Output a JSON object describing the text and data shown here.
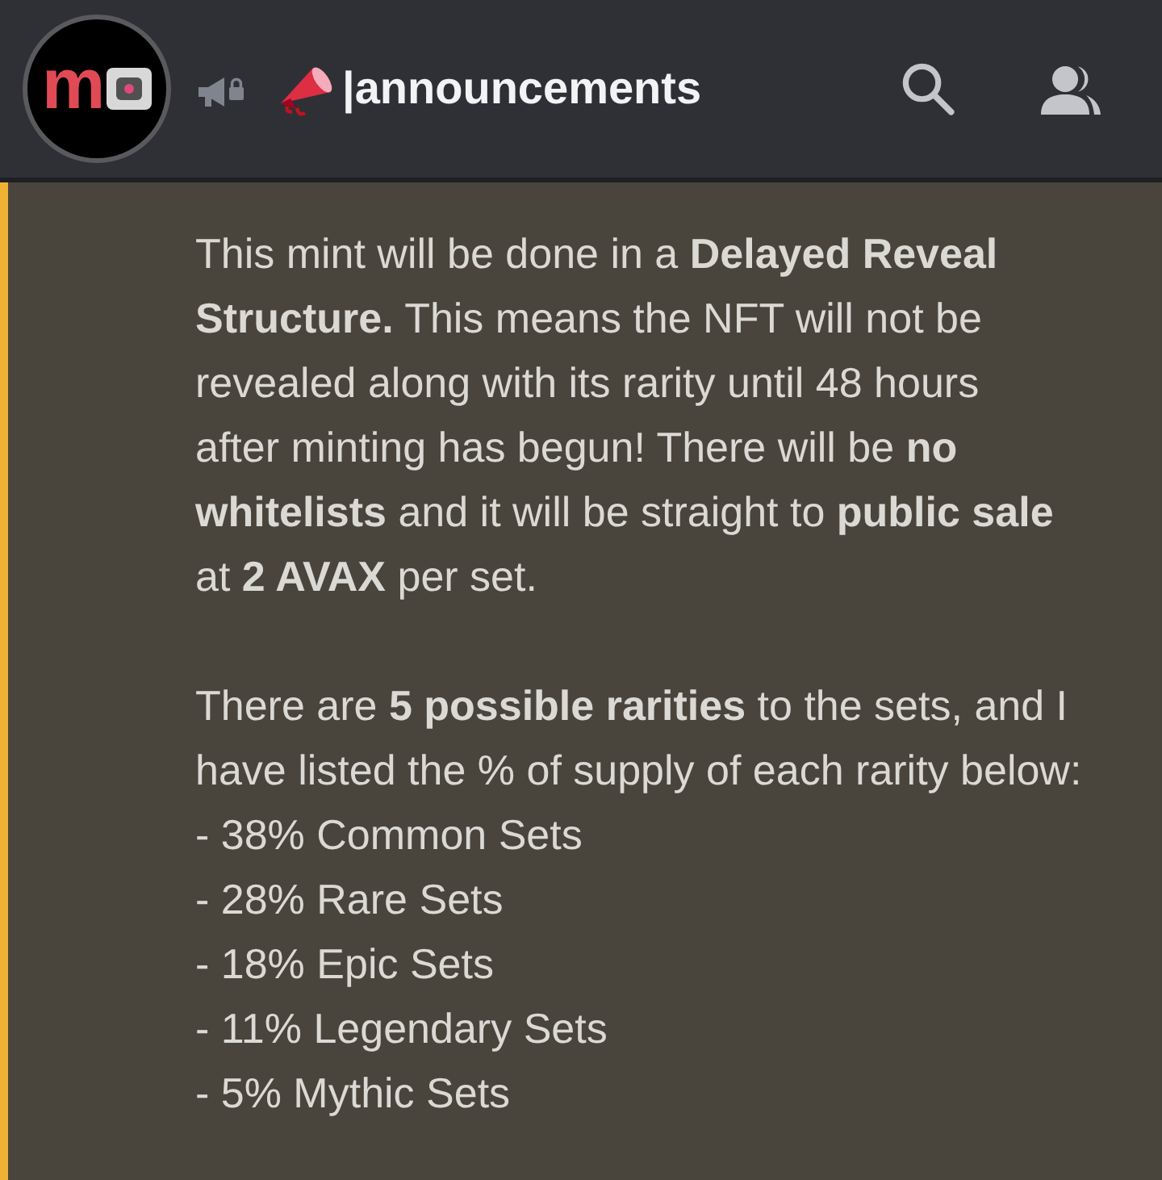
{
  "header": {
    "avatar_letter": "m",
    "channel_name": "|announcements"
  },
  "message": {
    "highlighted": true,
    "paragraphs": [
      "This mint will be done in a **Delayed Reveal Structure.** This means the NFT will not be revealed along with its rarity until 48 hours after minting has begun! There will be **no whitelists** and it will be straight to **public sale** at **2 AVAX** per set.",
      "There are **5 possible rarities** to the sets, and I have listed the % of supply of each rarity below:"
    ],
    "list_lines": [
      "- 38% Common Sets",
      "- 28% Rare Sets",
      "- 18% Epic Sets",
      "- 11% Legendary Sets",
      "- 5% Mythic Sets"
    ]
  }
}
